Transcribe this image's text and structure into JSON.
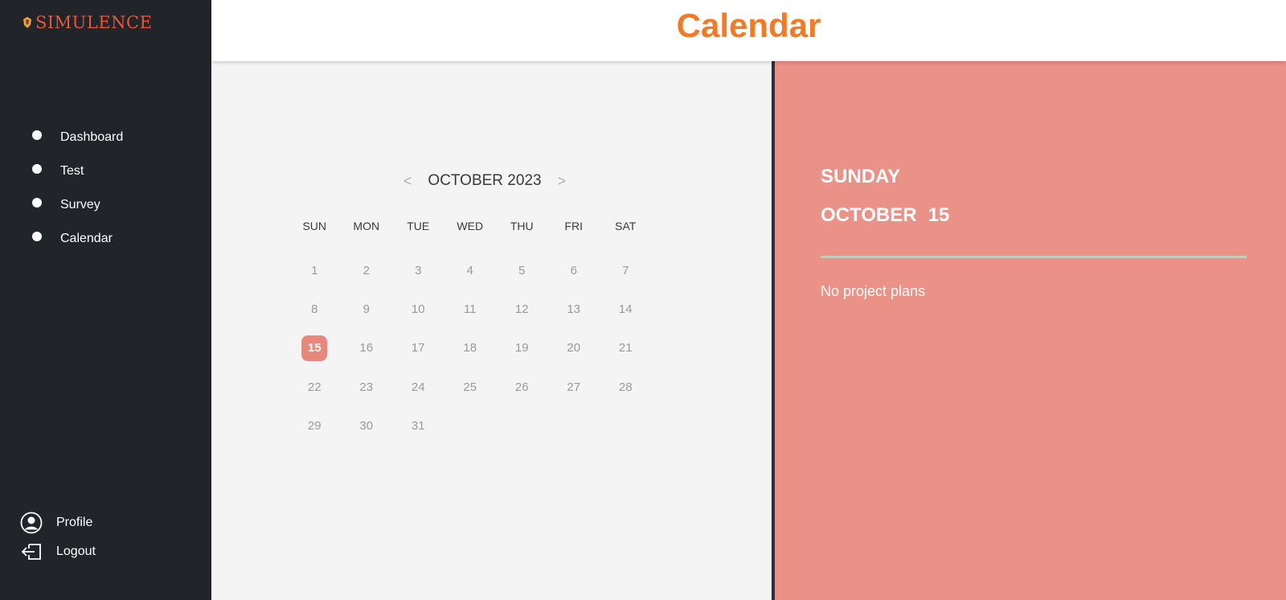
{
  "app": {
    "brand": "SIMULENCE",
    "brand_color": "#e8563b"
  },
  "sidebar": {
    "items": [
      {
        "label": "Dashboard"
      },
      {
        "label": "Test"
      },
      {
        "label": "Survey"
      },
      {
        "label": "Calendar"
      }
    ],
    "bottom": [
      {
        "label": "Profile",
        "icon": "user-circle-icon"
      },
      {
        "label": "Logout",
        "icon": "logout-icon"
      }
    ]
  },
  "header": {
    "title": "Calendar",
    "title_color": "#f47a27"
  },
  "calendar": {
    "month_label": "OCTOBER 2023",
    "prev": "<",
    "next": ">",
    "weekdays": [
      "SUN",
      "MON",
      "TUE",
      "WED",
      "THU",
      "FRI",
      "SAT"
    ],
    "days": [
      "1",
      "2",
      "3",
      "4",
      "5",
      "6",
      "7",
      "8",
      "9",
      "10",
      "11",
      "12",
      "13",
      "14",
      "15",
      "16",
      "17",
      "18",
      "19",
      "20",
      "21",
      "22",
      "23",
      "24",
      "25",
      "26",
      "27",
      "28",
      "29",
      "30",
      "31"
    ],
    "selected_day": "15",
    "selected_color": "#e8877b"
  },
  "detail": {
    "weekday": "SUNDAY",
    "month": "OCTOBER",
    "day": "15",
    "plans_text": "No project plans",
    "panel_color": "#ea9287"
  }
}
